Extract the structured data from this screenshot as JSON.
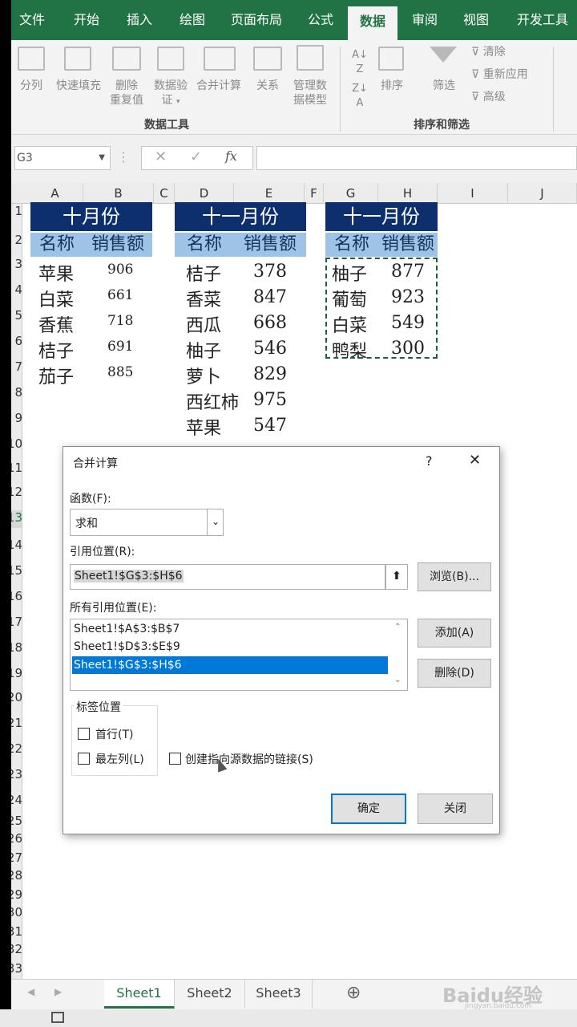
{
  "ribbon": {
    "tabs": [
      "文件",
      "开始",
      "插入",
      "绘图",
      "页面布局",
      "公式",
      "数据",
      "审阅",
      "视图",
      "开发工具"
    ],
    "active_tab": "数据",
    "data_tools": {
      "split": "分列",
      "flash_fill": "快速填充",
      "remove_dup_1": "删除",
      "remove_dup_2": "重复值",
      "validate_1": "数据验",
      "validate_2": "证",
      "consolidate": "合并计算",
      "relations": "关系",
      "model_1": "管理数",
      "model_2": "据模型",
      "group_label": "数据工具"
    },
    "sort_filter": {
      "sort": "排序",
      "filter": "筛选",
      "clear": "清除",
      "reapply": "重新应用",
      "advanced": "高级",
      "group_label": "排序和筛选"
    }
  },
  "formula_bar": {
    "name_box": "G3",
    "cancel_icon": "✕",
    "enter_icon": "✓",
    "fx_icon": "fx",
    "formula": ""
  },
  "sheet": {
    "columns": [
      "A",
      "B",
      "C",
      "D",
      "E",
      "F",
      "G",
      "H",
      "I",
      "J"
    ],
    "rows": [
      "1",
      "2",
      "3",
      "4",
      "5",
      "6",
      "7",
      "8",
      "9",
      "10",
      "11",
      "12",
      "13",
      "14",
      "15",
      "16",
      "17",
      "18",
      "19",
      "20",
      "21",
      "22",
      "23",
      "24",
      "25",
      "26",
      "27",
      "28",
      "29",
      "30",
      "31",
      "32",
      "33"
    ],
    "table1": {
      "title": "十月份",
      "header_name": "名称",
      "header_sales": "销售额",
      "rows": [
        [
          "苹果",
          "906"
        ],
        [
          "白菜",
          "661"
        ],
        [
          "香蕉",
          "718"
        ],
        [
          "桔子",
          "691"
        ],
        [
          "茄子",
          "885"
        ]
      ]
    },
    "table2": {
      "title": "十一月份",
      "header_name": "名称",
      "header_sales": "销售额",
      "rows": [
        [
          "桔子",
          "378"
        ],
        [
          "香菜",
          "847"
        ],
        [
          "西瓜",
          "668"
        ],
        [
          "柚子",
          "546"
        ],
        [
          "萝卜",
          "829"
        ],
        [
          "西红柿",
          "975"
        ],
        [
          "苹果",
          "547"
        ]
      ]
    },
    "table3": {
      "title": "十一月份",
      "header_name": "名称",
      "header_sales": "销售额",
      "rows": [
        [
          "柚子",
          "877"
        ],
        [
          "葡萄",
          "923"
        ],
        [
          "白菜",
          "549"
        ],
        [
          "鸭梨",
          "300"
        ]
      ]
    }
  },
  "sheet_tabs": [
    "Sheet1",
    "Sheet2",
    "Sheet3"
  ],
  "add_sheet": "⊕",
  "watermark": "Baidu经验",
  "watermark_url": "jingyan.baidu.com",
  "dialog": {
    "title": "合并计算",
    "help": "?",
    "close": "✕",
    "function_label": "函数(F):",
    "function_value": "求和",
    "ref_label": "引用位置(R):",
    "ref_value": "Sheet1!$G$3:$H$6",
    "browse": "浏览(B)...",
    "all_refs_label": "所有引用位置(E):",
    "all_refs": [
      "Sheet1!$A$3:$B$7",
      "Sheet1!$D$3:$E$9",
      "Sheet1!$G$3:$H$6"
    ],
    "add": "添加(A)",
    "delete": "删除(D)",
    "label_pos_title": "标签位置",
    "top_row": "首行(T)",
    "left_col": "最左列(L)",
    "create_links": "创建指向源数据的链接(S)",
    "ok": "确定",
    "cancel": "关闭"
  },
  "colors": {
    "excel_green": "#217346",
    "header_dark": "#0d2f6e",
    "header_light": "#9dc3e6",
    "selection_blue": "#0078d7"
  }
}
